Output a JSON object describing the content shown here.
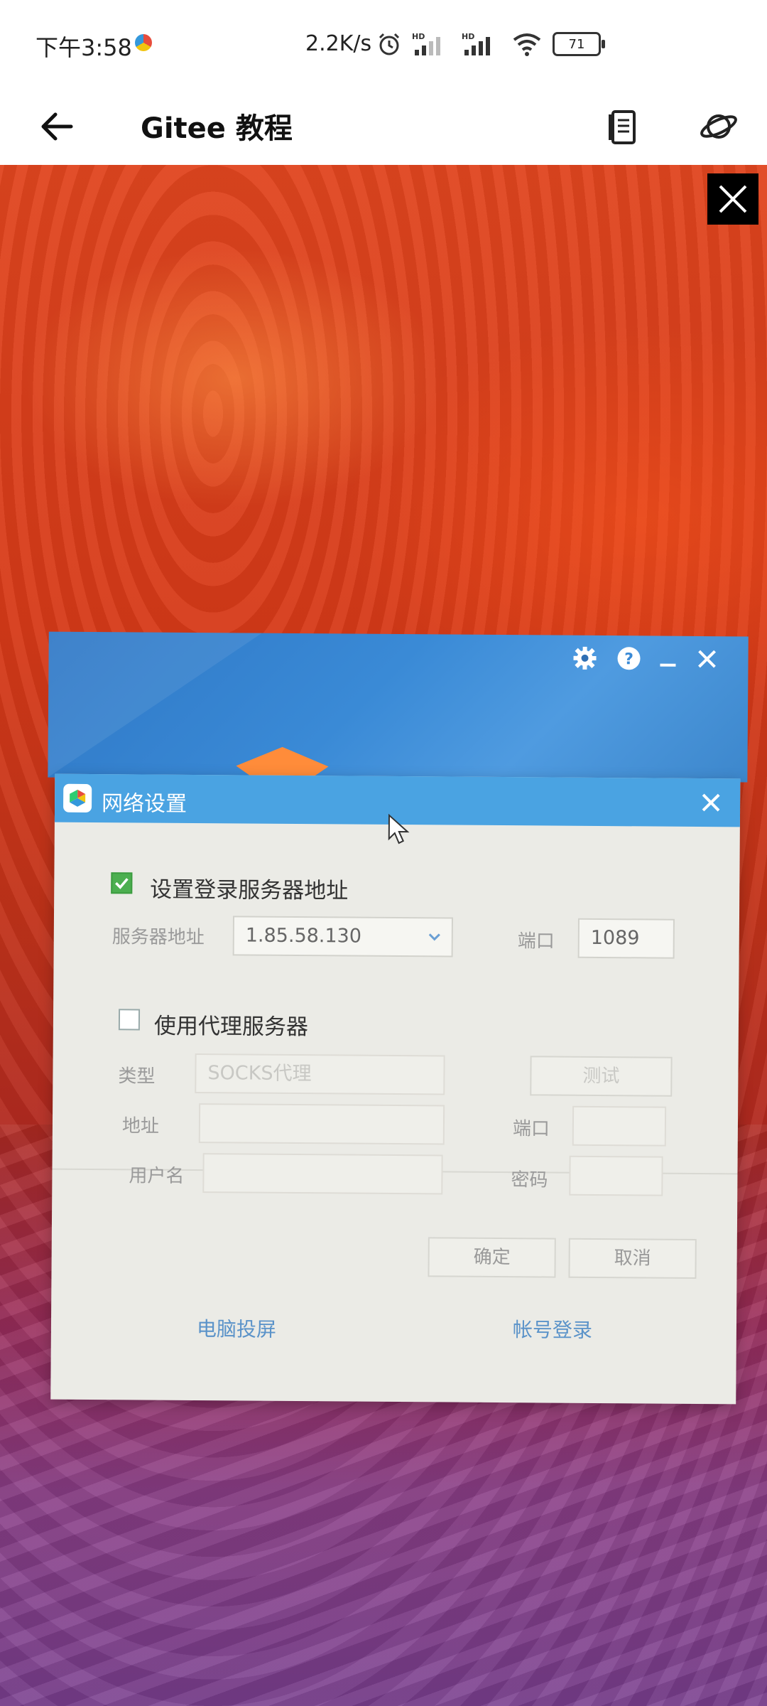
{
  "status_bar": {
    "time": "下午3:58",
    "net_speed": "2.2K/s",
    "battery": "71"
  },
  "app_bar": {
    "title": "Gitee 教程"
  },
  "dialog": {
    "title": "网络设置",
    "server_checkbox_label": "设置登录服务器地址",
    "server_address_label": "服务器地址",
    "server_address_value": "1.85.58.130",
    "port_label": "端口",
    "port_value": "1089",
    "proxy_checkbox_label": "使用代理服务器",
    "type_label": "类型",
    "type_value": "SOCKS代理",
    "test_button": "测试",
    "address_label": "地址",
    "proxy_port_label": "端口",
    "username_label": "用户名",
    "password_label": "密码",
    "ok_button": "确定",
    "cancel_button": "取消"
  },
  "footer_links": {
    "screen_cast": "电脑投屏",
    "account_login": "帐号登录"
  },
  "icons": {
    "back": "arrow-left-icon",
    "document": "document-icon",
    "planet": "planet-icon",
    "close_overlay": "close-icon"
  },
  "colors": {
    "dialog_title_bar": "#4aa3e2",
    "window_header": "#3a8ad6",
    "checkbox_checked": "#4caf50",
    "link": "#5b93c9"
  }
}
